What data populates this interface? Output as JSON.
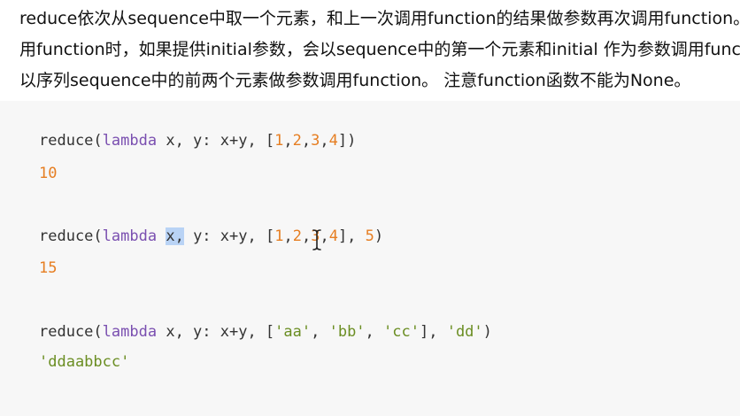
{
  "paragraph": {
    "line1": "reduce依次从sequence中取一个元素，和上一次调用function的结果做参数再次调用function。第一次调",
    "line2": "用function时，如果提供initial参数，会以sequence中的第一个元素和initial 作为参数调用function，否则会",
    "line3": "以序列sequence中的前两个元素做参数调用function。 注意function函数不能为None。"
  },
  "examples": [
    {
      "fn": "reduce",
      "open": "(",
      "kw": "lambda",
      "params": " x, y: x+y, [",
      "items": [
        "1",
        "2",
        "3",
        "4"
      ],
      "list_close": "]",
      "extra": "",
      "close": ")",
      "output": "10"
    },
    {
      "fn": "reduce",
      "open": "(",
      "kw": "lambda",
      "sel": "x,",
      "params": " y: x+y, [",
      "items": [
        "1",
        "2",
        "3",
        "4"
      ],
      "list_close": "], ",
      "extra": "5",
      "close": ")",
      "output": "15"
    },
    {
      "fn": "reduce",
      "open": "(",
      "kw": "lambda",
      "params": " x, y: x+y, [",
      "items": [
        "'aa'",
        "'bb'",
        "'cc'"
      ],
      "list_close": "], ",
      "extra": "'dd'",
      "close": ")",
      "output": "'ddaabbcc'"
    }
  ],
  "punct": {
    "space": " ",
    "comma": ",",
    "comma_space": ", "
  },
  "icons": {
    "cursor": "text-cursor-icon"
  }
}
